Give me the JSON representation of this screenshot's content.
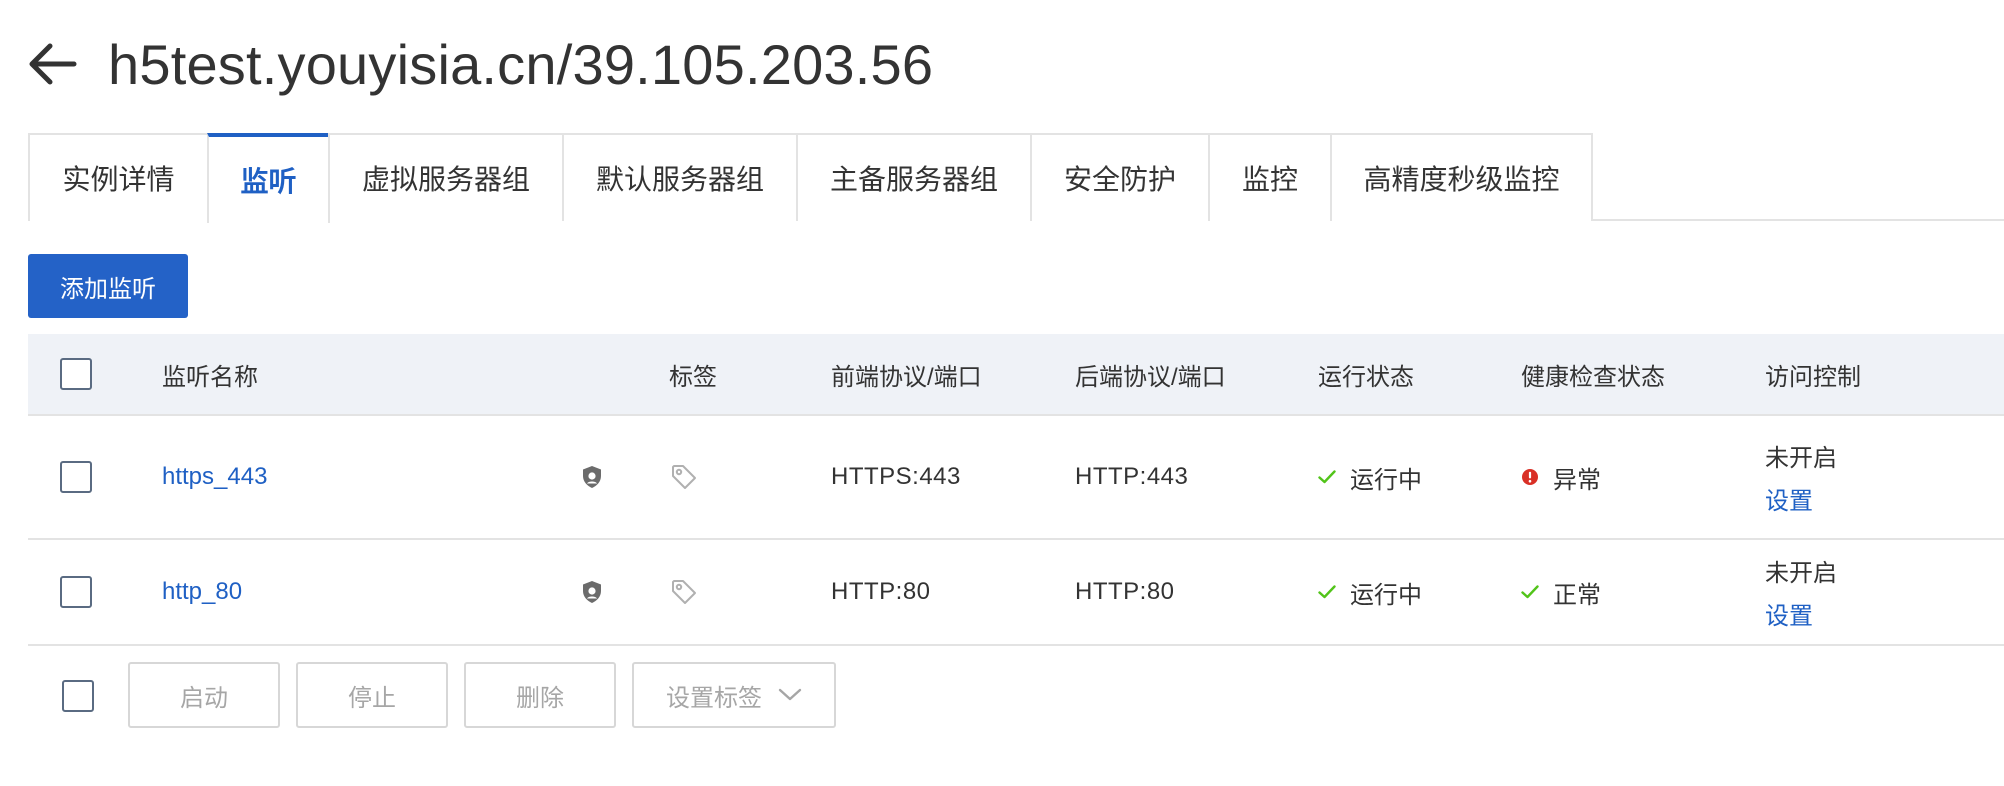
{
  "header": {
    "title": "h5test.youyisia.cn/39.105.203.56"
  },
  "tabs": [
    {
      "label": "实例详情",
      "active": false
    },
    {
      "label": "监听",
      "active": true
    },
    {
      "label": "虚拟服务器组",
      "active": false
    },
    {
      "label": "默认服务器组",
      "active": false
    },
    {
      "label": "主备服务器组",
      "active": false
    },
    {
      "label": "安全防护",
      "active": false
    },
    {
      "label": "监控",
      "active": false
    },
    {
      "label": "高精度秒级监控",
      "active": false
    }
  ],
  "toolbar": {
    "add_label": "添加监听"
  },
  "table": {
    "headers": {
      "name": "监听名称",
      "tags": "标签",
      "frontend": "前端协议/端口",
      "backend": "后端协议/端口",
      "run_status": "运行状态",
      "health_status": "健康检查状态",
      "access_control": "访问控制"
    },
    "rows": [
      {
        "name": "https_443",
        "frontend": "HTTPS:443",
        "backend": "HTTP:443",
        "run_status": "运行中",
        "health_status": "异常",
        "health_ok": false,
        "access_control": "未开启",
        "access_action": "设置"
      },
      {
        "name": "http_80",
        "frontend": "HTTP:80",
        "backend": "HTTP:80",
        "run_status": "运行中",
        "health_status": "正常",
        "health_ok": true,
        "access_control": "未开启",
        "access_action": "设置"
      }
    ]
  },
  "bulk_actions": {
    "start_label": "启动",
    "stop_label": "停止",
    "delete_label": "删除",
    "set_tags_label": "设置标签"
  },
  "colors": {
    "accent": "#1f60c4",
    "primary_button": "#2462c7",
    "success": "#52c41a",
    "error": "#d93026",
    "header_bg": "#eff2f7"
  }
}
